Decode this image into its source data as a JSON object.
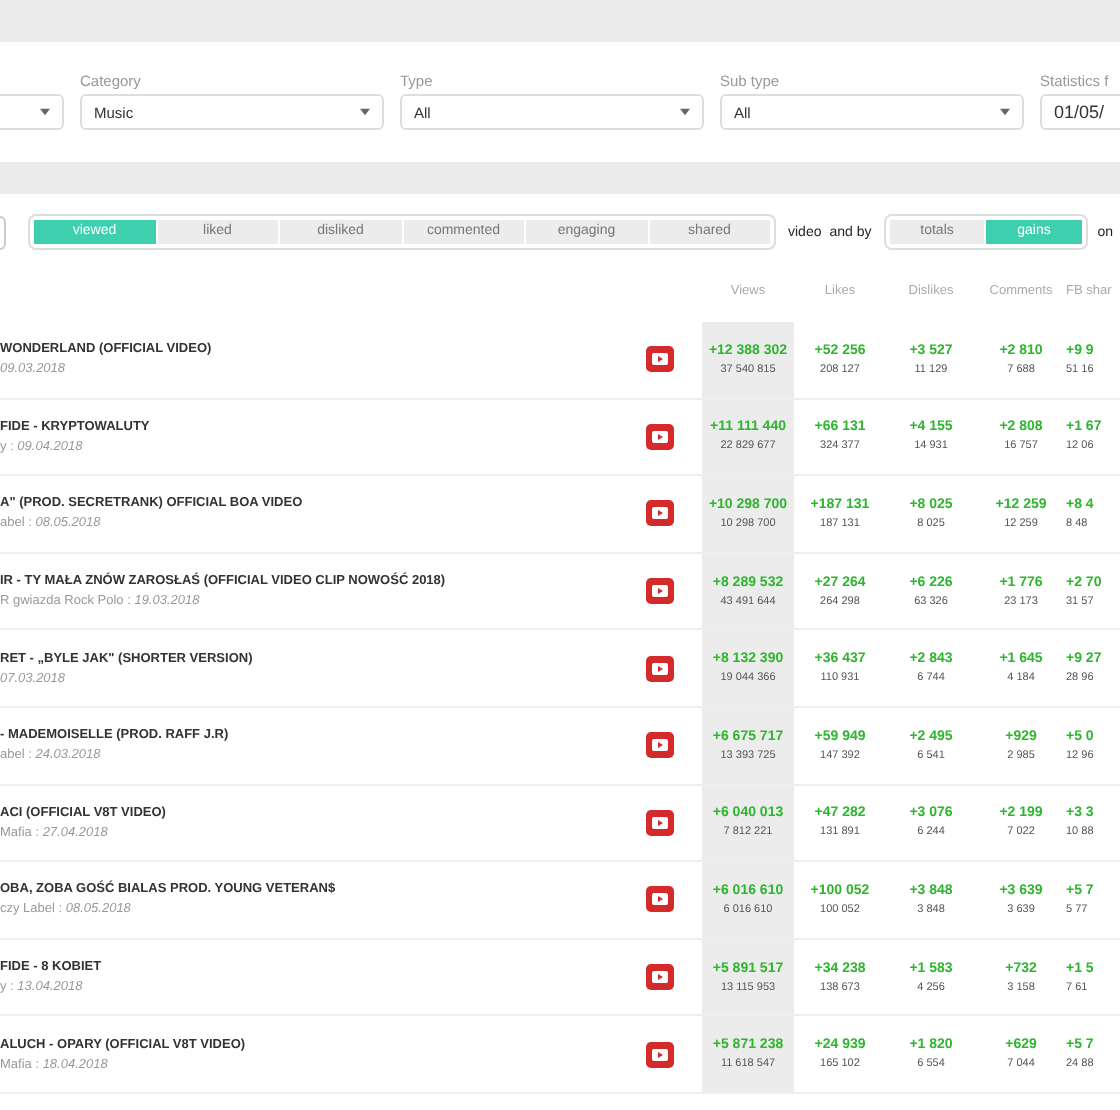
{
  "filters": [
    {
      "kind": "dropdown"
    },
    {
      "kind": "dropdown",
      "label": "Category",
      "value": "Music"
    },
    {
      "kind": "dropdown",
      "label": "Type",
      "value": "All"
    },
    {
      "kind": "dropdown",
      "label": "Sub type",
      "value": "All"
    },
    {
      "kind": "date",
      "label": "Statistics f",
      "value": "01/05/"
    }
  ],
  "metric_tabs": [
    {
      "label": "viewed",
      "selected": true
    },
    {
      "label": "liked",
      "selected": false
    },
    {
      "label": "disliked",
      "selected": false
    },
    {
      "label": "commented",
      "selected": false
    },
    {
      "label": "engaging",
      "selected": false
    },
    {
      "label": "shared",
      "selected": false
    }
  ],
  "text_video": "video",
  "text_and_by": "and by",
  "mode_tabs": [
    {
      "label": "totals",
      "selected": false
    },
    {
      "label": "gains",
      "selected": true
    }
  ],
  "text_on": "on",
  "columns": [
    "Views",
    "Likes",
    "Dislikes",
    "Comments",
    "FB shar"
  ],
  "rows": [
    {
      "title": "WONDERLAND (OFFICIAL VIDEO)",
      "subtitle": "*09.03.2018*",
      "stats": [
        [
          "+12 388 302",
          "37 540 815"
        ],
        [
          "+52 256",
          "208 127"
        ],
        [
          "+3 527",
          "11 129"
        ],
        [
          "+2 810",
          "7 688"
        ],
        [
          "+9 9",
          "51 16"
        ]
      ]
    },
    {
      "title": "FIDE - KRYPTOWALUTY",
      "subtitle": "y : *09.04.2018*",
      "stats": [
        [
          "+11 111 440",
          "22 829 677"
        ],
        [
          "+66 131",
          "324 377"
        ],
        [
          "+4 155",
          "14 931"
        ],
        [
          "+2 808",
          "16 757"
        ],
        [
          "+1 67",
          "12 06"
        ]
      ]
    },
    {
      "title": "A\" (PROD. SECRETRANK) OFFICIAL BOA VIDEO",
      "subtitle": "abel : *08.05.2018*",
      "stats": [
        [
          "+10 298 700",
          "10 298 700"
        ],
        [
          "+187 131",
          "187 131"
        ],
        [
          "+8 025",
          "8 025"
        ],
        [
          "+12 259",
          "12 259"
        ],
        [
          "+8 4",
          "8 48"
        ]
      ]
    },
    {
      "title": "IR - TY MAŁA ZNÓW ZAROSŁAŚ (OFFICIAL VIDEO CLIP NOWOŚĆ 2018)",
      "subtitle": "R gwiazda Rock Polo : *19.03.2018*",
      "stats": [
        [
          "+8 289 532",
          "43 491 644"
        ],
        [
          "+27 264",
          "264 298"
        ],
        [
          "+6 226",
          "63 326"
        ],
        [
          "+1 776",
          "23 173"
        ],
        [
          "+2 70",
          "31 57"
        ]
      ]
    },
    {
      "title": "RET - „BYLE JAK\" (SHORTER VERSION)",
      "subtitle": "*07.03.2018*",
      "stats": [
        [
          "+8 132 390",
          "19 044 366"
        ],
        [
          "+36 437",
          "110 931"
        ],
        [
          "+2 843",
          "6 744"
        ],
        [
          "+1 645",
          "4 184"
        ],
        [
          "+9 27",
          "28 96"
        ]
      ]
    },
    {
      "title": "- MADEMOISELLE (PROD. RAFF J.R)",
      "subtitle": "abel : *24.03.2018*",
      "stats": [
        [
          "+6 675 717",
          "13 393 725"
        ],
        [
          "+59 949",
          "147 392"
        ],
        [
          "+2 495",
          "6 541"
        ],
        [
          "+929",
          "2 985"
        ],
        [
          "+5 0",
          "12 96"
        ]
      ]
    },
    {
      "title": "ACI (OFFICIAL V8T VIDEO)",
      "subtitle": "Mafia : *27.04.2018*",
      "stats": [
        [
          "+6 040 013",
          "7 812 221"
        ],
        [
          "+47 282",
          "131 891"
        ],
        [
          "+3 076",
          "6 244"
        ],
        [
          "+2 199",
          "7 022"
        ],
        [
          "+3 3",
          "10 88"
        ]
      ]
    },
    {
      "title": "OBA, ZOBA GOŚĆ BIALAS PROD. YOUNG VETERAN$",
      "subtitle": "czy Label : *08.05.2018*",
      "stats": [
        [
          "+6 016 610",
          "6 016 610"
        ],
        [
          "+100 052",
          "100 052"
        ],
        [
          "+3 848",
          "3 848"
        ],
        [
          "+3 639",
          "3 639"
        ],
        [
          "+5 7",
          "5 77"
        ]
      ]
    },
    {
      "title": "FIDE - 8 KOBIET",
      "subtitle": "y : *13.04.2018*",
      "stats": [
        [
          "+5 891 517",
          "13 115 953"
        ],
        [
          "+34 238",
          "138 673"
        ],
        [
          "+1 583",
          "4 256"
        ],
        [
          "+732",
          "3 158"
        ],
        [
          "+1 5",
          "7 61"
        ]
      ]
    },
    {
      "title": "ALUCH - OPARY (OFFICIAL V8T VIDEO)",
      "subtitle": "Mafia : *18.04.2018*",
      "stats": [
        [
          "+5 871 238",
          "11 618 547"
        ],
        [
          "+24 939",
          "165 102"
        ],
        [
          "+1 820",
          "6 554"
        ],
        [
          "+629",
          "7 044"
        ],
        [
          "+5 7",
          "24 88"
        ]
      ]
    }
  ]
}
